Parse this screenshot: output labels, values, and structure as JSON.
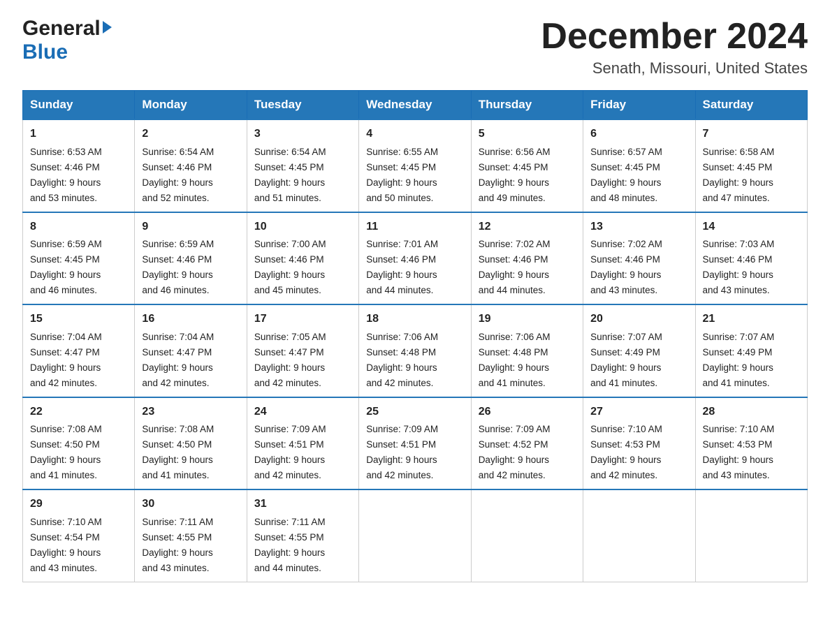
{
  "logo": {
    "general": "General",
    "blue": "Blue"
  },
  "title": "December 2024",
  "subtitle": "Senath, Missouri, United States",
  "days_header": [
    "Sunday",
    "Monday",
    "Tuesday",
    "Wednesday",
    "Thursday",
    "Friday",
    "Saturday"
  ],
  "weeks": [
    [
      {
        "day": "1",
        "sunrise": "6:53 AM",
        "sunset": "4:46 PM",
        "daylight": "9 hours and 53 minutes."
      },
      {
        "day": "2",
        "sunrise": "6:54 AM",
        "sunset": "4:46 PM",
        "daylight": "9 hours and 52 minutes."
      },
      {
        "day": "3",
        "sunrise": "6:54 AM",
        "sunset": "4:45 PM",
        "daylight": "9 hours and 51 minutes."
      },
      {
        "day": "4",
        "sunrise": "6:55 AM",
        "sunset": "4:45 PM",
        "daylight": "9 hours and 50 minutes."
      },
      {
        "day": "5",
        "sunrise": "6:56 AM",
        "sunset": "4:45 PM",
        "daylight": "9 hours and 49 minutes."
      },
      {
        "day": "6",
        "sunrise": "6:57 AM",
        "sunset": "4:45 PM",
        "daylight": "9 hours and 48 minutes."
      },
      {
        "day": "7",
        "sunrise": "6:58 AM",
        "sunset": "4:45 PM",
        "daylight": "9 hours and 47 minutes."
      }
    ],
    [
      {
        "day": "8",
        "sunrise": "6:59 AM",
        "sunset": "4:45 PM",
        "daylight": "9 hours and 46 minutes."
      },
      {
        "day": "9",
        "sunrise": "6:59 AM",
        "sunset": "4:46 PM",
        "daylight": "9 hours and 46 minutes."
      },
      {
        "day": "10",
        "sunrise": "7:00 AM",
        "sunset": "4:46 PM",
        "daylight": "9 hours and 45 minutes."
      },
      {
        "day": "11",
        "sunrise": "7:01 AM",
        "sunset": "4:46 PM",
        "daylight": "9 hours and 44 minutes."
      },
      {
        "day": "12",
        "sunrise": "7:02 AM",
        "sunset": "4:46 PM",
        "daylight": "9 hours and 44 minutes."
      },
      {
        "day": "13",
        "sunrise": "7:02 AM",
        "sunset": "4:46 PM",
        "daylight": "9 hours and 43 minutes."
      },
      {
        "day": "14",
        "sunrise": "7:03 AM",
        "sunset": "4:46 PM",
        "daylight": "9 hours and 43 minutes."
      }
    ],
    [
      {
        "day": "15",
        "sunrise": "7:04 AM",
        "sunset": "4:47 PM",
        "daylight": "9 hours and 42 minutes."
      },
      {
        "day": "16",
        "sunrise": "7:04 AM",
        "sunset": "4:47 PM",
        "daylight": "9 hours and 42 minutes."
      },
      {
        "day": "17",
        "sunrise": "7:05 AM",
        "sunset": "4:47 PM",
        "daylight": "9 hours and 42 minutes."
      },
      {
        "day": "18",
        "sunrise": "7:06 AM",
        "sunset": "4:48 PM",
        "daylight": "9 hours and 42 minutes."
      },
      {
        "day": "19",
        "sunrise": "7:06 AM",
        "sunset": "4:48 PM",
        "daylight": "9 hours and 41 minutes."
      },
      {
        "day": "20",
        "sunrise": "7:07 AM",
        "sunset": "4:49 PM",
        "daylight": "9 hours and 41 minutes."
      },
      {
        "day": "21",
        "sunrise": "7:07 AM",
        "sunset": "4:49 PM",
        "daylight": "9 hours and 41 minutes."
      }
    ],
    [
      {
        "day": "22",
        "sunrise": "7:08 AM",
        "sunset": "4:50 PM",
        "daylight": "9 hours and 41 minutes."
      },
      {
        "day": "23",
        "sunrise": "7:08 AM",
        "sunset": "4:50 PM",
        "daylight": "9 hours and 41 minutes."
      },
      {
        "day": "24",
        "sunrise": "7:09 AM",
        "sunset": "4:51 PM",
        "daylight": "9 hours and 42 minutes."
      },
      {
        "day": "25",
        "sunrise": "7:09 AM",
        "sunset": "4:51 PM",
        "daylight": "9 hours and 42 minutes."
      },
      {
        "day": "26",
        "sunrise": "7:09 AM",
        "sunset": "4:52 PM",
        "daylight": "9 hours and 42 minutes."
      },
      {
        "day": "27",
        "sunrise": "7:10 AM",
        "sunset": "4:53 PM",
        "daylight": "9 hours and 42 minutes."
      },
      {
        "day": "28",
        "sunrise": "7:10 AM",
        "sunset": "4:53 PM",
        "daylight": "9 hours and 43 minutes."
      }
    ],
    [
      {
        "day": "29",
        "sunrise": "7:10 AM",
        "sunset": "4:54 PM",
        "daylight": "9 hours and 43 minutes."
      },
      {
        "day": "30",
        "sunrise": "7:11 AM",
        "sunset": "4:55 PM",
        "daylight": "9 hours and 43 minutes."
      },
      {
        "day": "31",
        "sunrise": "7:11 AM",
        "sunset": "4:55 PM",
        "daylight": "9 hours and 44 minutes."
      },
      null,
      null,
      null,
      null
    ]
  ],
  "sunrise_label": "Sunrise:",
  "sunset_label": "Sunset:",
  "daylight_label": "Daylight:"
}
